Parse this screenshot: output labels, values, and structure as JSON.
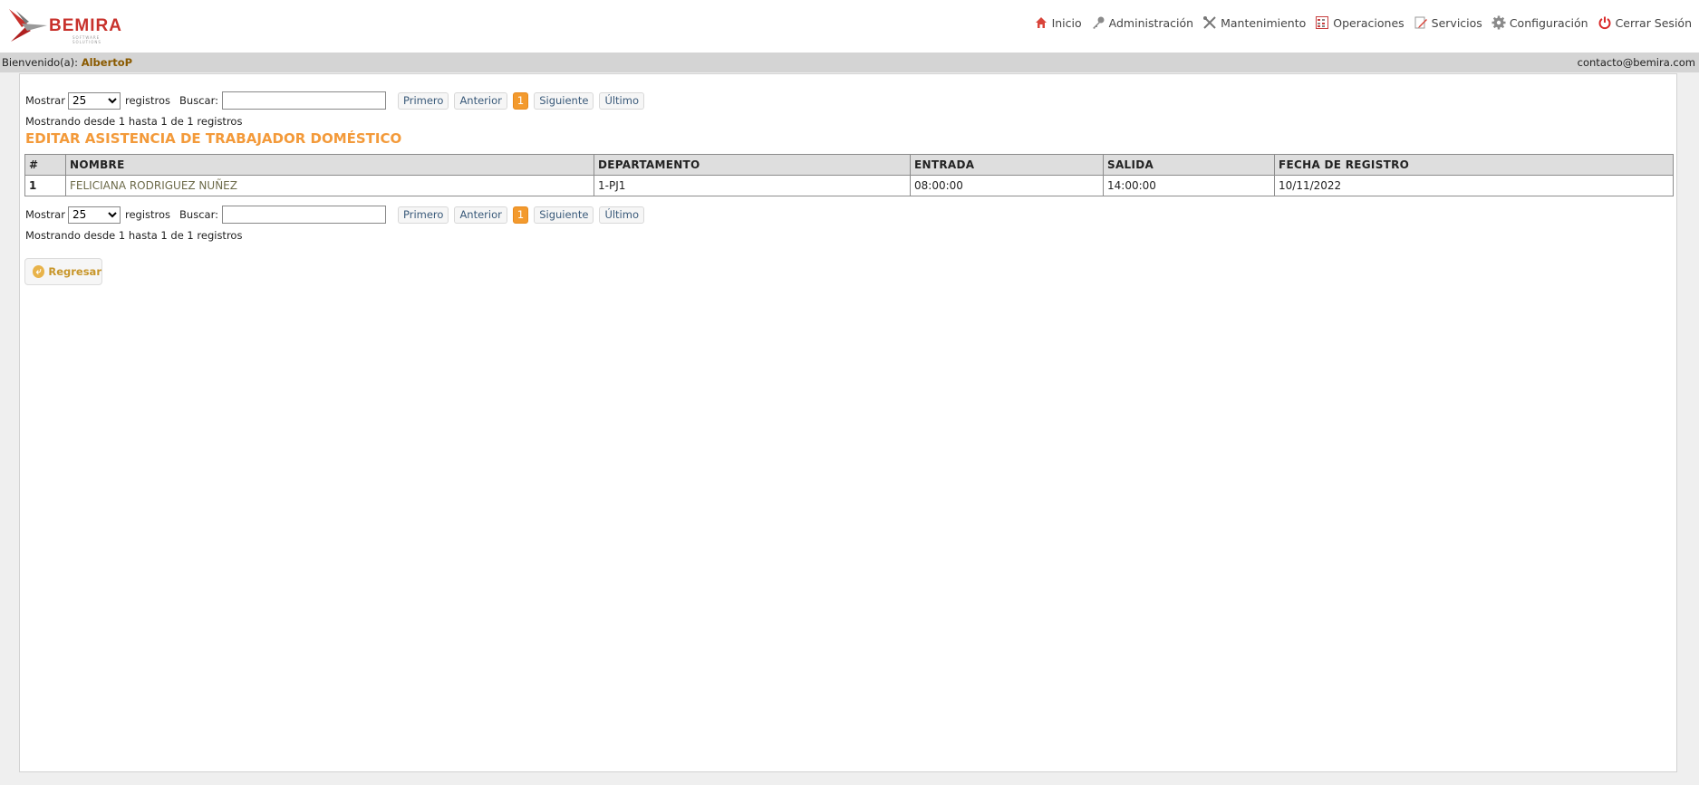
{
  "brand": {
    "name": "BEMIRA",
    "tagline": "SOFTWARE SOLUTIONS"
  },
  "nav": [
    {
      "label": "Inicio",
      "icon": "home-icon"
    },
    {
      "label": "Administración",
      "icon": "key-icon"
    },
    {
      "label": "Mantenimiento",
      "icon": "tools-icon"
    },
    {
      "label": "Operaciones",
      "icon": "grid-icon"
    },
    {
      "label": "Servicios",
      "icon": "edit-icon"
    },
    {
      "label": "Configuración",
      "icon": "gear-icon"
    },
    {
      "label": "Cerrar Sesión",
      "icon": "power-icon"
    }
  ],
  "welcome": {
    "label": "Bienvenido(a):",
    "user": "AlbertoP",
    "email": "contacto@bemira.com"
  },
  "table_controls": {
    "show_label": "Mostrar",
    "show_value": "25",
    "records_label": "registros",
    "search_label": "Buscar:",
    "search_value": "",
    "pager": {
      "first": "Primero",
      "prev": "Anterior",
      "current": "1",
      "next": "Siguiente",
      "last": "Último"
    },
    "info": "Mostrando desde 1 hasta 1 de 1 registros"
  },
  "page_title": "EDITAR ASISTENCIA DE TRABAJADOR DOMÉSTICO",
  "table": {
    "headers": [
      "#",
      "NOMBRE",
      "DEPARTAMENTO",
      "ENTRADA",
      "SALIDA",
      "FECHA DE REGISTRO"
    ],
    "rows": [
      [
        "1",
        "FELICIANA RODRIGUEZ NUÑEZ",
        "1-PJ1",
        "08:00:00",
        "14:00:00",
        "10/11/2022"
      ]
    ]
  },
  "back_button": "Regresar",
  "colors": {
    "accent": "#f39a3a",
    "brand_red": "#c8322c",
    "page_bg": "#efefef",
    "welcome_bar": "#d4d4d4"
  }
}
